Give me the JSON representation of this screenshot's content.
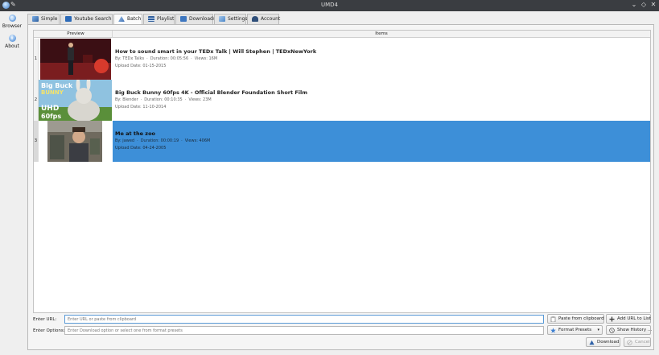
{
  "window": {
    "title": "UMD4"
  },
  "leftnav": [
    {
      "label": "Browser",
      "icon": "browser-icon"
    },
    {
      "label": "About",
      "icon": "info-icon"
    }
  ],
  "tabs": [
    {
      "label": "Simple",
      "icon": "simple-icon",
      "color": "#4a7fc0"
    },
    {
      "label": "Youtube Search",
      "icon": "youtube-icon",
      "color": "#2c6ab8"
    },
    {
      "label": "Batch",
      "icon": "batch-icon",
      "color": "#3d6fb3",
      "active": true
    },
    {
      "label": "Playlist",
      "icon": "playlist-icon",
      "color": "#2f5e9d"
    },
    {
      "label": "Downloads",
      "icon": "downloads-icon",
      "color": "#3e77c0"
    },
    {
      "label": "Settings",
      "icon": "settings-icon",
      "color": "#4a86c8"
    },
    {
      "label": "Account",
      "icon": "account-icon",
      "color": "#2f4f7a"
    }
  ],
  "table": {
    "headers": {
      "preview": "Preview",
      "items": "Items"
    },
    "rows": [
      {
        "num": "1",
        "title": "How to sound smart in your TEDx Talk | Will Stephen | TEDxNewYork",
        "by": "By: TEDx Talks",
        "duration": "Duration: 00:05:56",
        "views": "Views: 16M",
        "upload": "Upload Date: 01-15-2015",
        "thumb": "ted-talk-thumbnail"
      },
      {
        "num": "2",
        "title": "Big Buck Bunny 60fps 4K - Official Blender Foundation Short Film",
        "by": "By: Blender",
        "duration": "Duration: 00:10:35",
        "views": "Views: 23M",
        "upload": "Upload Date: 11-10-2014",
        "thumb": "big-buck-bunny-thumbnail",
        "thumb_text": [
          "Big Buck",
          "BUNNY",
          "UHD",
          "60fps"
        ]
      },
      {
        "num": "3",
        "title": "Me at the zoo",
        "by": "By: jawed",
        "duration": "Duration: 00:00:19",
        "views": "Views: 406M",
        "upload": "Upload Date: 04-24-2005",
        "thumb": "me-at-the-zoo-thumbnail",
        "selected": true
      }
    ]
  },
  "url": {
    "label": "Enter URL:",
    "placeholder": "Enter URL or paste from clipboard"
  },
  "options": {
    "label": "Enter Options:",
    "placeholder": "Enter Download option or select one from format presets"
  },
  "buttons": {
    "paste": "Paste from clipboard",
    "add": "Add URL to List",
    "presets": "Format Presets",
    "history": "Show History ...",
    "download": "Download",
    "cancel": "Cancel"
  },
  "colors": {
    "selection": "#3d8fd8",
    "accent": "#3d7fd0"
  }
}
